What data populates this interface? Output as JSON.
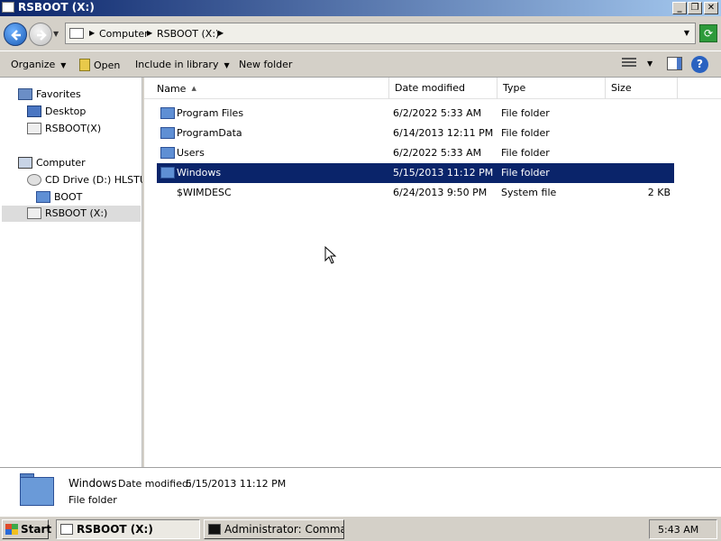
{
  "window": {
    "title": "RSBOOT (X:)",
    "controls": {
      "minimize": "_",
      "restore": "❐",
      "close": "✕"
    }
  },
  "address": {
    "breadcrumbs": [
      "Computer",
      "RSBOOT (X:)"
    ]
  },
  "toolbar": {
    "organize": "Organize",
    "open": "Open",
    "include_in_library": "Include in library",
    "new_folder": "New folder",
    "help_glyph": "?"
  },
  "navigation": {
    "favorites": "Favorites",
    "desktop": "Desktop",
    "rsboot_fav": "RSBOOT(X)",
    "computer": "Computer",
    "cd_drive": "CD Drive (D:) HLSTUDIO",
    "boot": "BOOT",
    "rsboot_x": "RSBOOT (X:)"
  },
  "columns": {
    "name": "Name",
    "date_modified": "Date modified",
    "type": "Type",
    "size": "Size"
  },
  "files": [
    {
      "name": "Program Files",
      "date": "6/2/2022 5:33 AM",
      "type": "File folder",
      "size": "",
      "icon": "folder-icon"
    },
    {
      "name": "ProgramData",
      "date": "6/14/2013 12:11 PM",
      "type": "File folder",
      "size": "",
      "icon": "folder-icon"
    },
    {
      "name": "Users",
      "date": "6/2/2022 5:33 AM",
      "type": "File folder",
      "size": "",
      "icon": "folder-icon"
    },
    {
      "name": "Windows",
      "date": "5/15/2013 11:12 PM",
      "type": "File folder",
      "size": "",
      "icon": "folder-icon",
      "selected": true
    },
    {
      "name": "$WIMDESC",
      "date": "6/24/2013 9:50 PM",
      "type": "System file",
      "size": "2 KB",
      "icon": "file-icon"
    }
  ],
  "details": {
    "name": "Windows",
    "modified_label": "Date modified:",
    "modified_value": "5/15/2013 11:12 PM",
    "type": "File folder"
  },
  "taskbar": {
    "start": "Start",
    "tasks": [
      "RSBOOT (X:)",
      "Administrator: Command..."
    ],
    "clock": "5:43 AM"
  },
  "colors": {
    "selection": "#0a246a",
    "titlebar_start": "#0a246a",
    "titlebar_end": "#a6caf0"
  }
}
